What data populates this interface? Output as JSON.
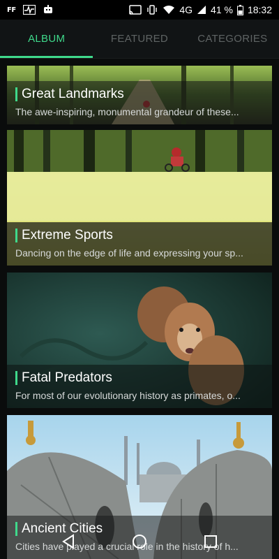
{
  "status_bar": {
    "left_indicator": "FF",
    "network": "4G",
    "battery": "41 %",
    "time": "18:32"
  },
  "tabs": [
    {
      "label": "ALBUM",
      "active": true
    },
    {
      "label": "FEATURED",
      "active": false
    },
    {
      "label": "CATEGORIES",
      "active": false
    }
  ],
  "albums": [
    {
      "title": "Great Landmarks",
      "description": "The awe-inspiring, monumental grandeur of these..."
    },
    {
      "title": "Extreme Sports",
      "description": "Dancing on the edge of life and expressing your sp..."
    },
    {
      "title": "Fatal Predators",
      "description": "For most of our evolutionary history as primates, o..."
    },
    {
      "title": "Ancient Cities",
      "description": "Cities have played a crucial role in the history of h..."
    }
  ],
  "colors": {
    "accent": "#3fd98b",
    "background": "#0b0d0d",
    "tab_inactive": "#5f6464"
  },
  "nav": {
    "back_icon": "back-icon",
    "home_icon": "home-icon",
    "recents_icon": "recents-icon"
  }
}
